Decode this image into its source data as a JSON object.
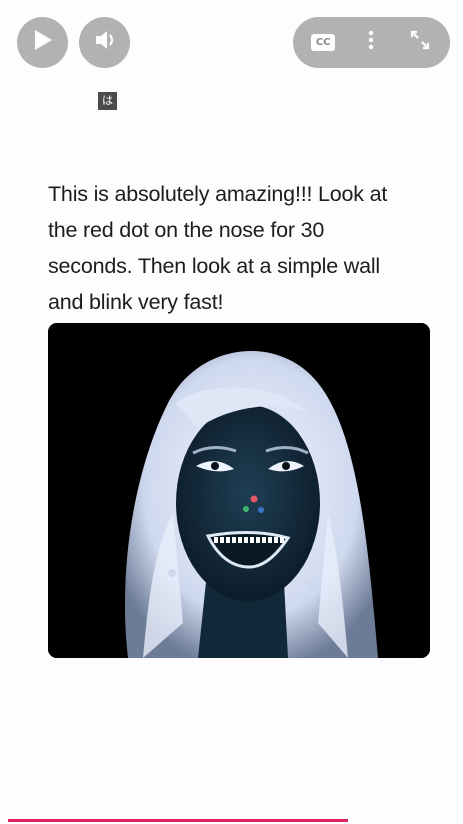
{
  "player": {
    "play_icon": "play-icon",
    "volume_icon": "volume-icon",
    "cc_label": "CC",
    "more_icon": "more-vertical-icon",
    "fullscreen_icon": "fullscreen-icon",
    "progress_fraction": 0.76,
    "accent_color": "#e0245e"
  },
  "overlay": {
    "char_badge": "は"
  },
  "post": {
    "caption_lines": [
      "This is absolutely amazing!!! Look at",
      "the red dot on the nose for 30",
      "seconds. Then look at a simple wall",
      "and blink very fast!"
    ]
  }
}
